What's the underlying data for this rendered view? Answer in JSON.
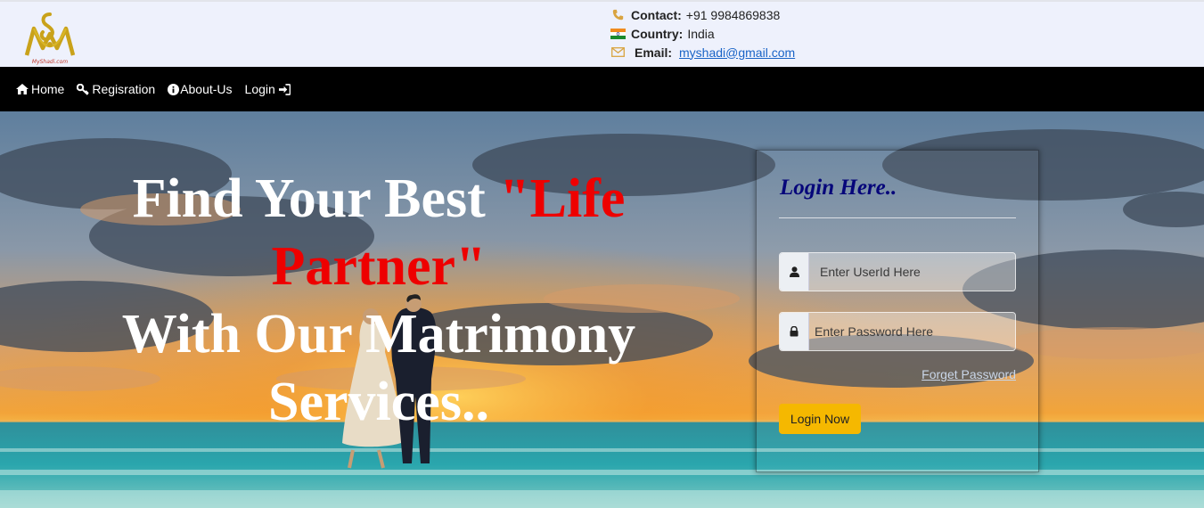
{
  "header": {
    "logo_text": "MyShadi.com",
    "contact": {
      "label": "Contact:",
      "value": "+91 9984869838"
    },
    "country": {
      "label": "Country:",
      "value": "India"
    },
    "email": {
      "label": "Email:",
      "value": "myshadi@gmail.com"
    }
  },
  "nav": {
    "items": [
      {
        "label": "Home",
        "icon": "home-icon"
      },
      {
        "label": "Regisration",
        "icon": "key-icon"
      },
      {
        "label": "About-Us",
        "icon": "info-circle-icon"
      },
      {
        "label": "Login",
        "icon": "sign-in-icon"
      }
    ]
  },
  "hero": {
    "line1_pre": "Find Your Best ",
    "line1_highlight": "\"Life Partner\"",
    "line2": "With Our Matrimony",
    "line3": "Services.."
  },
  "login": {
    "title": "Login Here..",
    "userid_placeholder": "Enter UserId Here",
    "password_placeholder": "Enter Password Here",
    "forgot_label": "Forget Password",
    "submit_label": "Login Now"
  },
  "colors": {
    "topbar_bg": "#eef1fc",
    "nav_bg": "#000000",
    "highlight": "#ee0000",
    "login_title": "#06067a",
    "button": "#f5b800",
    "link": "#1a64c7"
  }
}
